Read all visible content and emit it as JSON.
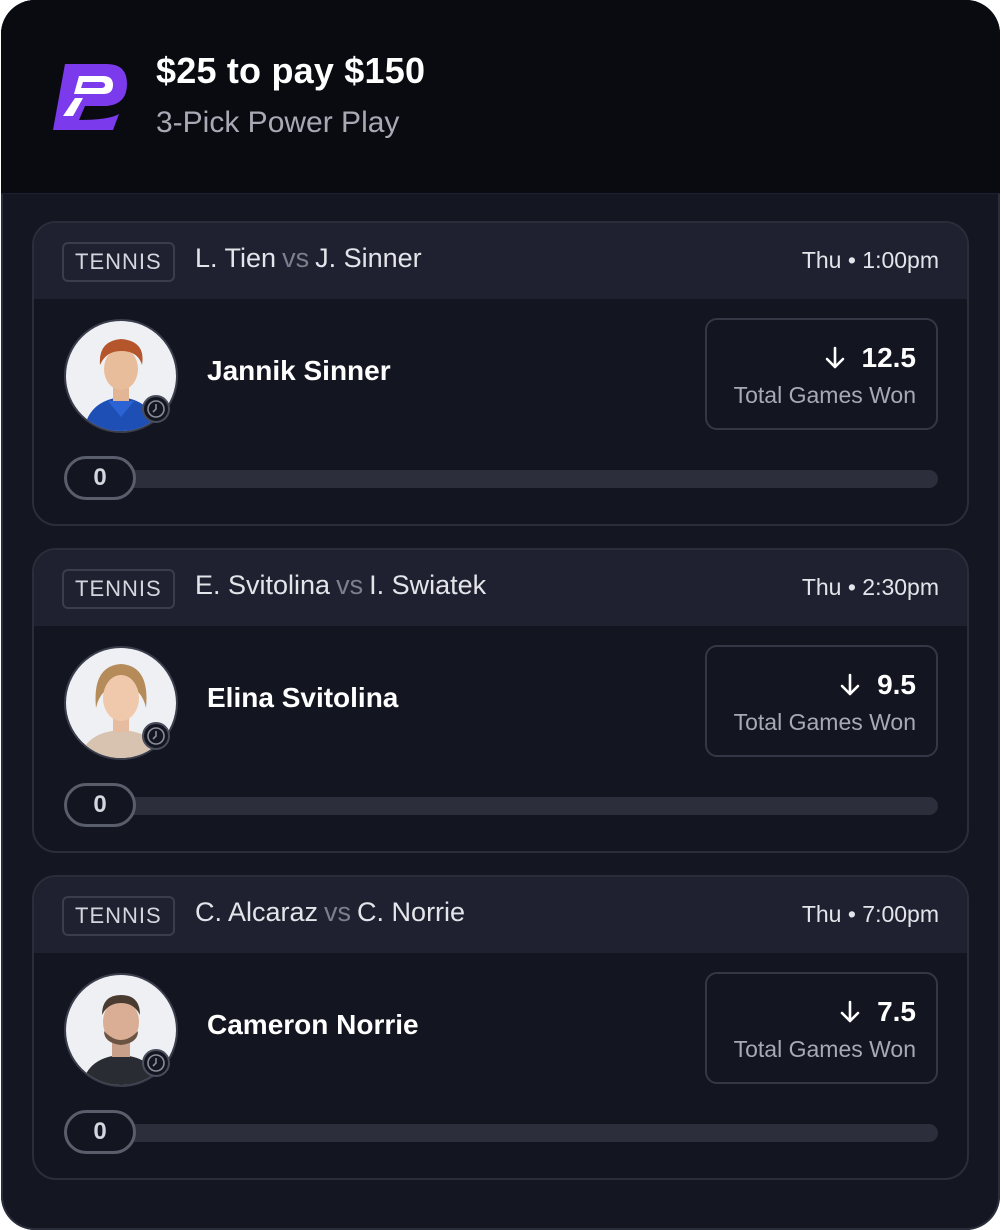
{
  "header": {
    "stake_text": "$25 to pay $150",
    "play_type": "3-Pick Power Play",
    "brand_color": "#7c3aed"
  },
  "picks": [
    {
      "sport": "TENNIS",
      "team_a": "L. Tien",
      "vs": "vs",
      "team_b": "J. Sinner",
      "time": "Thu • 1:00pm",
      "player": "Jannik Sinner",
      "direction": "down",
      "line": "12.5",
      "stat": "Total Games Won",
      "progress_value": "0",
      "progress_fraction": 0
    },
    {
      "sport": "TENNIS",
      "team_a": "E. Svitolina",
      "vs": "vs",
      "team_b": "I. Swiatek",
      "time": "Thu • 2:30pm",
      "player": "Elina Svitolina",
      "direction": "down",
      "line": "9.5",
      "stat": "Total Games Won",
      "progress_value": "0",
      "progress_fraction": 0
    },
    {
      "sport": "TENNIS",
      "team_a": "C. Alcaraz",
      "vs": "vs",
      "team_b": "C. Norrie",
      "time": "Thu • 7:00pm",
      "player": "Cameron Norrie",
      "direction": "down",
      "line": "7.5",
      "stat": "Total Games Won",
      "progress_value": "0",
      "progress_fraction": 0
    }
  ],
  "icons": {
    "logo": "prizepicks-logo-icon",
    "arrow": "arrow-down-icon",
    "clock": "clock-icon"
  }
}
